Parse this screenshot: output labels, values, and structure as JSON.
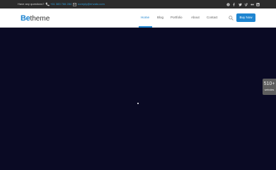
{
  "topbar": {
    "question": "Have any questions?",
    "phone": "+61 383 766 284",
    "email": "noreply@envato.com",
    "social_icons": [
      "skype-icon",
      "facebook-icon",
      "twitter-icon",
      "vimeo-icon",
      "flickr-icon",
      "linkedin-icon"
    ]
  },
  "header": {
    "logo_be": "Be",
    "logo_theme": "theme",
    "nav": [
      {
        "label": "Home",
        "active": true
      },
      {
        "label": "Blog"
      },
      {
        "label": "Portfolio"
      },
      {
        "label": "About"
      },
      {
        "label": "Contact"
      }
    ],
    "buy_label": "Buy Now"
  },
  "side_badge": {
    "number": "510+",
    "label": "websites"
  },
  "colors": {
    "accent": "#1f85d0",
    "topbar_bg": "#2c2c2c",
    "hero_bg": "#0a0a24"
  }
}
